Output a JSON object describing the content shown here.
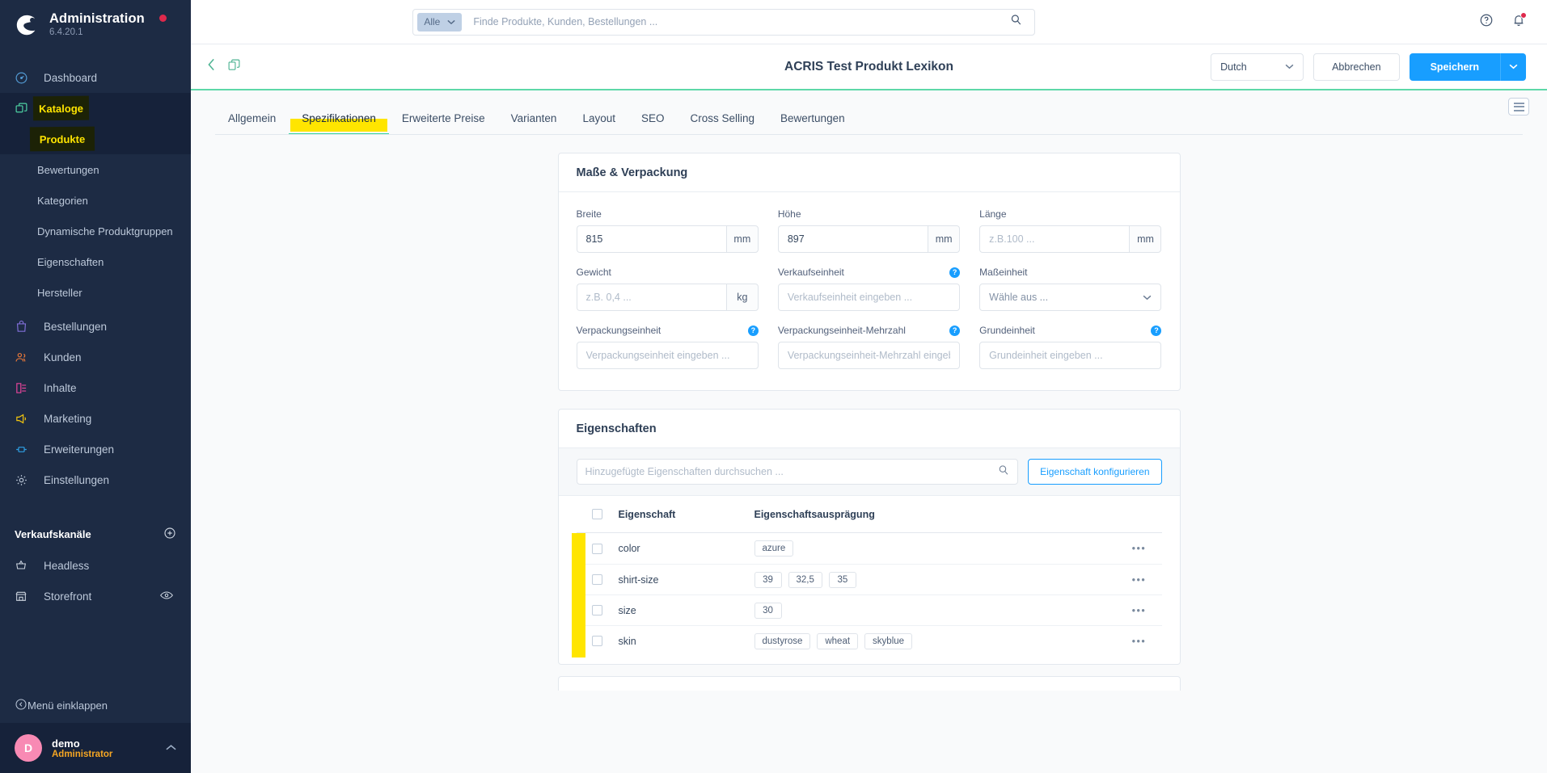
{
  "sidebar": {
    "brand": {
      "title": "Administration",
      "version": "6.4.20.1"
    },
    "nav": [
      {
        "label": "Dashboard",
        "icon": "dashboard-icon"
      },
      {
        "label": "Kataloge",
        "icon": "catalog-icon",
        "highlighted": true
      },
      {
        "label": "Bestellungen",
        "icon": "orders-icon"
      },
      {
        "label": "Kunden",
        "icon": "customers-icon"
      },
      {
        "label": "Inhalte",
        "icon": "content-icon"
      },
      {
        "label": "Marketing",
        "icon": "marketing-icon"
      },
      {
        "label": "Erweiterungen",
        "icon": "extensions-icon"
      },
      {
        "label": "Einstellungen",
        "icon": "settings-gear-icon"
      }
    ],
    "catalog_sub": [
      {
        "label": "Produkte",
        "current": true,
        "highlighted": true
      },
      {
        "label": "Bewertungen"
      },
      {
        "label": "Kategorien"
      },
      {
        "label": "Dynamische Produktgruppen"
      },
      {
        "label": "Eigenschaften"
      },
      {
        "label": "Hersteller"
      }
    ],
    "sales_channels": {
      "title": "Verkaufskanäle",
      "add_icon": "plus-circle-icon",
      "items": [
        {
          "label": "Headless",
          "icon": "basket-icon"
        },
        {
          "label": "Storefront",
          "icon": "store-icon",
          "trailing_icon": "eye-icon"
        }
      ]
    },
    "collapse_label": "Menü einklappen",
    "user": {
      "initial": "D",
      "name": "demo",
      "role": "Administrator"
    },
    "colors": {
      "bg": "#1d2b44",
      "active": "#16223a",
      "highlight_text": "#ffe500"
    }
  },
  "topbar": {
    "search": {
      "scope": "Alle",
      "placeholder": "Finde Produkte, Kunden, Bestellungen ...",
      "value": ""
    },
    "icons": [
      "help-circle-icon",
      "notification-bell-icon"
    ]
  },
  "header": {
    "title": "ACRIS Test Produkt Lexikon",
    "back_icon": "chevron-left-icon",
    "duplicate_icon": "duplicate-icon",
    "language": "Dutch",
    "cancel_label": "Abbrechen",
    "save_label": "Speichern",
    "accent": "#189eff"
  },
  "tabs": {
    "items": [
      {
        "label": "Allgemein"
      },
      {
        "label": "Spezifikationen",
        "active": true,
        "highlighted": true
      },
      {
        "label": "Erweiterte Preise"
      },
      {
        "label": "Varianten"
      },
      {
        "label": "Layout"
      },
      {
        "label": "SEO"
      },
      {
        "label": "Cross Selling"
      },
      {
        "label": "Bewertungen"
      }
    ]
  },
  "measurements_card": {
    "title": "Maße & Verpackung",
    "fields": [
      {
        "label": "Breite",
        "value": "815",
        "placeholder": "",
        "unit": "mm",
        "type": "text-unit"
      },
      {
        "label": "Höhe",
        "value": "897",
        "placeholder": "",
        "unit": "mm",
        "type": "text-unit"
      },
      {
        "label": "Länge",
        "value": "",
        "placeholder": "z.B.100 ...",
        "unit": "mm",
        "type": "text-unit"
      },
      {
        "label": "Gewicht",
        "value": "",
        "placeholder": "z.B. 0,4 ...",
        "unit": "kg",
        "type": "text-unit"
      },
      {
        "label": "Verkaufseinheit",
        "value": "",
        "placeholder": "Verkaufseinheit eingeben ...",
        "type": "text",
        "help": true
      },
      {
        "label": "Maßeinheit",
        "value": "Wähle aus ...",
        "type": "select"
      },
      {
        "label": "Verpackungseinheit",
        "value": "",
        "placeholder": "Verpackungseinheit eingeben ...",
        "type": "text",
        "help": true
      },
      {
        "label": "Verpackungseinheit-Mehrzahl",
        "value": "",
        "placeholder": "Verpackungseinheit-Mehrzahl eingeben ...",
        "type": "text",
        "help": true
      },
      {
        "label": "Grundeinheit",
        "value": "",
        "placeholder": "Grundeinheit eingeben ...",
        "type": "text",
        "help": true
      }
    ]
  },
  "properties_card": {
    "title": "Eigenschaften",
    "search_placeholder": "Hinzugefügte Eigenschaften durchsuchen ...",
    "search_value": "",
    "configure_label": "Eigenschaft konfigurieren",
    "columns": {
      "property": "Eigenschaft",
      "value": "Eigenschaftsausprägung"
    },
    "rows": [
      {
        "name": "color",
        "values": [
          "azure"
        ]
      },
      {
        "name": "shirt-size",
        "values": [
          "39",
          "32,5",
          "35"
        ]
      },
      {
        "name": "size",
        "values": [
          "30"
        ]
      },
      {
        "name": "skin",
        "values": [
          "dustyrose",
          "wheat",
          "skyblue"
        ]
      }
    ],
    "context_glyph": "•••"
  }
}
